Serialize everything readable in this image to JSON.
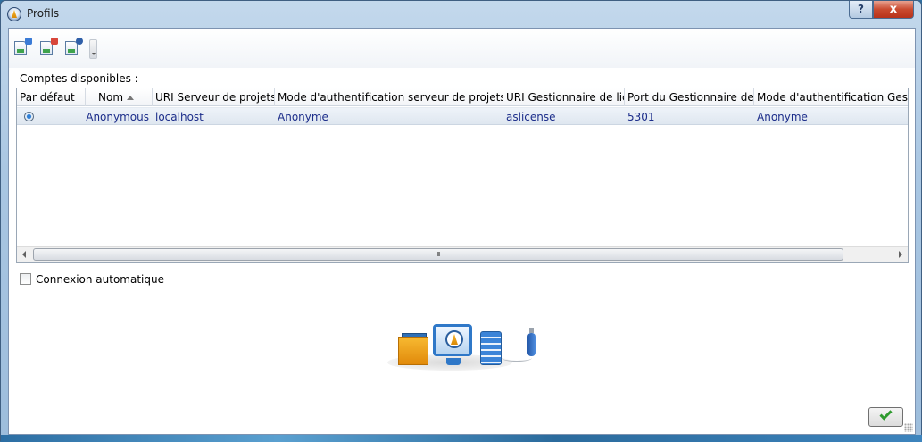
{
  "window": {
    "title": "Profils",
    "help_label": "?",
    "close_label": "x"
  },
  "toolbar": {
    "buttons": [
      {
        "name": "add-profile",
        "icon": "document-add-icon"
      },
      {
        "name": "delete-profile",
        "icon": "document-delete-icon"
      },
      {
        "name": "profile-settings",
        "icon": "document-gear-icon"
      }
    ]
  },
  "accounts": {
    "label": "Comptes disponibles :",
    "columns": [
      "Par défaut",
      "Nom",
      "URI Serveur de projets",
      "Mode d'authentification serveur de projets",
      "URI Gestionnaire de licenc",
      "Port du Gestionnaire de lic",
      "Mode d'authentification Gestionn"
    ],
    "sorted_column": "Nom",
    "sort_direction": "ascending",
    "rows": [
      {
        "default": true,
        "name": "Anonymous",
        "project_server_uri": "localhost",
        "project_server_auth": "Anonyme",
        "license_manager_uri": "aslicense",
        "license_manager_port": "5301",
        "license_manager_auth": "Anonyme"
      }
    ]
  },
  "auto_connect": {
    "label": "Connexion automatique",
    "checked": false
  },
  "colors": {
    "cell_text": "#1c2d8a",
    "selection": "#dfe7f0",
    "ok_check": "#2f9b2f"
  }
}
